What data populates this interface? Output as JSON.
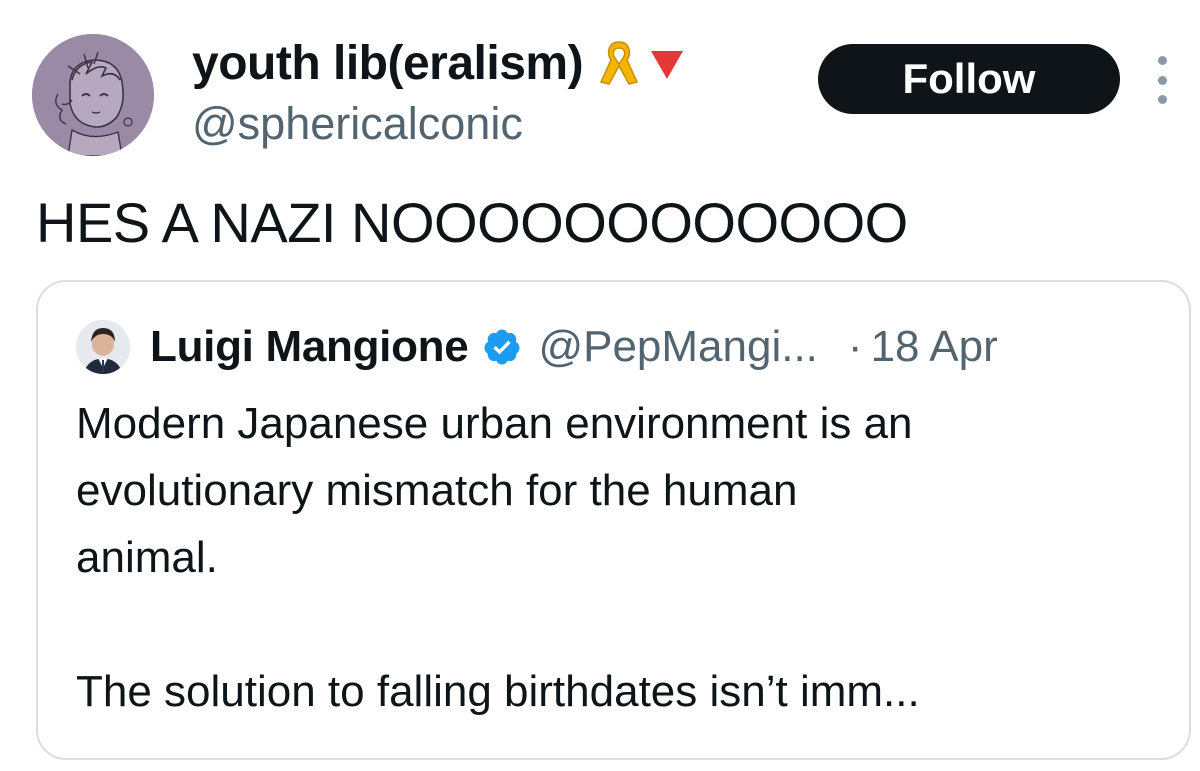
{
  "author": {
    "display_name": "youth lib(eralism)",
    "handle": "@sphericalconic",
    "avatar": "anime-character-sketch-avatar",
    "name_emojis": [
      "yellow-ribbon-icon",
      "red-down-triangle-icon"
    ],
    "avatar_color": "#9b8aa6"
  },
  "actions": {
    "follow_label": "Follow",
    "more_icon": "more-vertical-icon"
  },
  "tweet": {
    "text": "HES A NAZI NOOOOOOOOOOOO"
  },
  "quoted_tweet": {
    "display_name": "Luigi Mangione",
    "verified": true,
    "verified_color": "#1d9bf0",
    "handle": "@PepMangi...",
    "separator": "·",
    "time": "18 Apr",
    "text": "Modern Japanese urban environment is an\nevolutionary mismatch for the human\nanimal.\n\nThe solution to falling birthdates isn’t imm..."
  },
  "colors": {
    "text_primary": "#0f1419",
    "text_secondary": "#536471",
    "follow_bg": "#0f1419",
    "card_border": "#d8dee3"
  }
}
